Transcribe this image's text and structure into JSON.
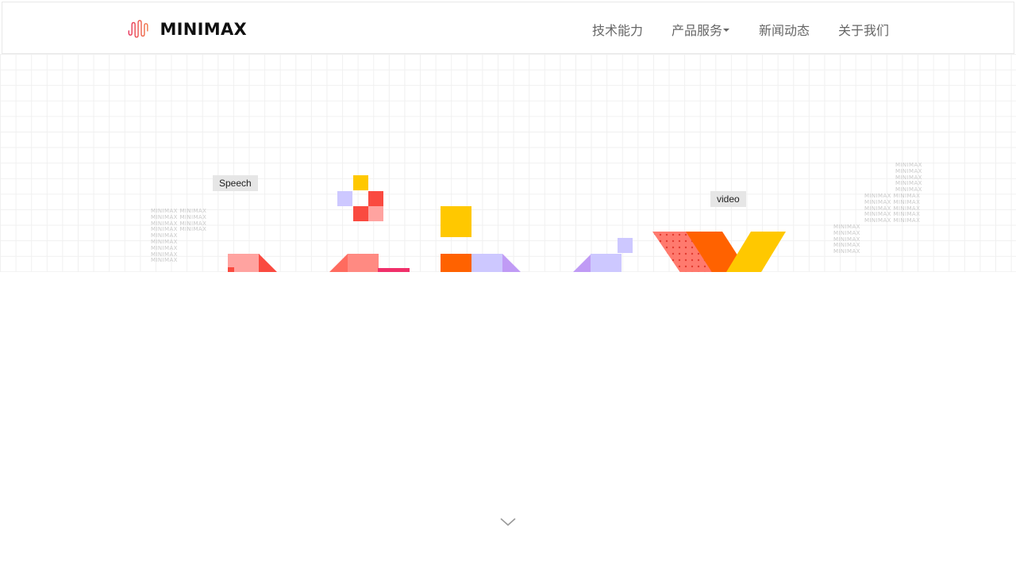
{
  "header": {
    "brand": "MINIMAX",
    "nav": [
      {
        "label": "技术能力"
      },
      {
        "label": "产品服务"
      },
      {
        "label": "新闻动态"
      },
      {
        "label": "关于我们"
      }
    ]
  },
  "hero": {
    "tags": [
      "Speech",
      "video"
    ],
    "watermark_word": "MINIMAX"
  },
  "colors": {
    "yellow": "#ffc800",
    "orange": "#ff6200",
    "red": "#fa4a40",
    "salmon": "#ff8a82",
    "pink": "#ffa3a0",
    "lavender": "#cdc8ff",
    "purple": "#c09bf5"
  },
  "icons": {
    "logo": "waveform-logo-icon",
    "scroll": "chevron-down-icon"
  }
}
